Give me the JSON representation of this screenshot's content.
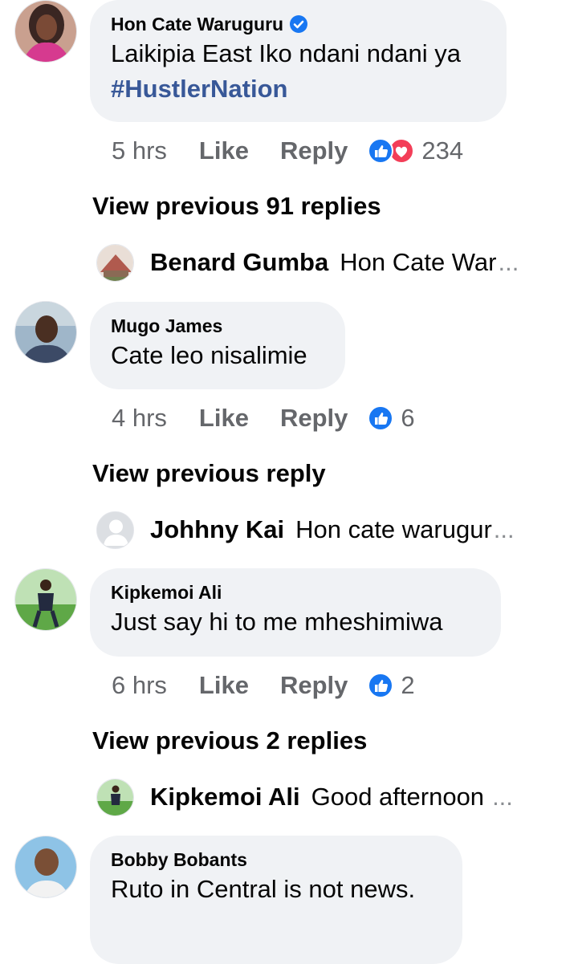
{
  "colors": {
    "bubble": "#f0f2f5",
    "secondary_text": "#65676b",
    "like_blue": "#1877f2",
    "love_red": "#f33e58",
    "hashtag": "#385898"
  },
  "comments": [
    {
      "author": "Hon Cate Waruguru",
      "verified": true,
      "text": "Laikipia East Iko ndani ndani ya",
      "hashtag": "#HustlerNation",
      "time": "5 hrs",
      "like_label": "Like",
      "reply_label": "Reply",
      "reactions": [
        "like-icon",
        "love-icon"
      ],
      "reaction_count": "234"
    },
    {
      "author": "Mugo James",
      "text": "Cate leo nisalimie",
      "time": "4 hrs",
      "like_label": "Like",
      "reply_label": "Reply",
      "reactions": [
        "like-icon"
      ],
      "reaction_count": "6"
    },
    {
      "author": "Kipkemoi Ali",
      "text": "Just say hi to me mheshimiwa",
      "time": "6 hrs",
      "like_label": "Like",
      "reply_label": "Reply",
      "reactions": [
        "like-icon"
      ],
      "reaction_count": "2"
    },
    {
      "author": "Bobby Bobants",
      "text": "Ruto in Central is not news."
    }
  ],
  "reply_threads": [
    {
      "view_previous": "View previous 91 replies",
      "preview_author": "Benard Gumba",
      "preview_text": "Hon Cate War",
      "ellipsis": "..."
    },
    {
      "view_previous": "View previous reply",
      "preview_author": "Johhny Kai",
      "preview_text": "Hon cate warugur",
      "ellipsis": "..."
    },
    {
      "view_previous": "View previous 2 replies",
      "preview_author": "Kipkemoi Ali",
      "preview_text": "Good afternoon",
      "ellipsis": "..."
    }
  ]
}
